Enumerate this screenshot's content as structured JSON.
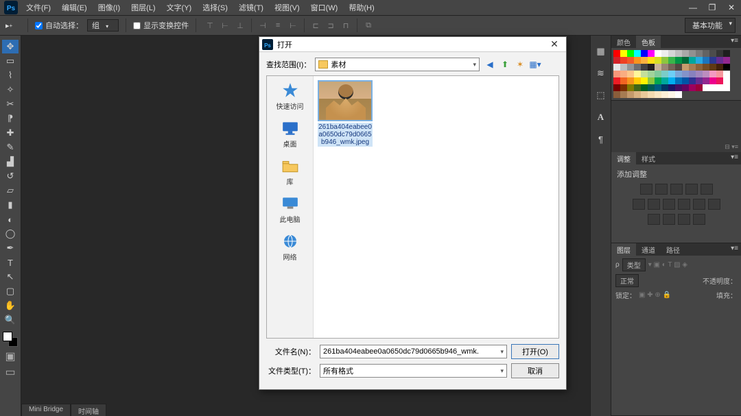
{
  "menubar": {
    "items": [
      "文件(F)",
      "编辑(E)",
      "图像(I)",
      "图层(L)",
      "文字(Y)",
      "选择(S)",
      "滤镜(T)",
      "视图(V)",
      "窗口(W)",
      "帮助(H)"
    ]
  },
  "optbar": {
    "auto_select_label": "自动选择：",
    "group_value": "组",
    "show_transform_label": "显示变换控件",
    "workspace": "基本功能"
  },
  "dialog": {
    "title": "打开",
    "lookin_label": "查找范围(I)：",
    "lookin_value": "素材",
    "places": [
      {
        "label": "快速访问"
      },
      {
        "label": "桌面"
      },
      {
        "label": "库"
      },
      {
        "label": "此电脑"
      },
      {
        "label": "网络"
      }
    ],
    "thumb_name": "261ba404eabee0a0650dc79d0665b946_wmk.jpeg",
    "filename_label": "文件名(N)：",
    "filename_value": "261ba404eabee0a0650dc79d0665b946_wmk.",
    "filetype_label": "文件类型(T)：",
    "filetype_value": "所有格式",
    "open_btn": "打开(O)",
    "cancel_btn": "取消"
  },
  "panels": {
    "color_tab": "颜色",
    "swatches_tab": "色板",
    "adjust_tab": "调整",
    "styles_tab": "样式",
    "adjust_title": "添加调整",
    "layers_tab": "图层",
    "channels_tab": "通道",
    "paths_tab": "路径",
    "layers_kind": "类型",
    "layers_mode": "正常",
    "layers_opacity_label": "不透明度：",
    "layers_lock_label": "锁定：",
    "layers_fill_label": "填充："
  },
  "doc_tabs": {
    "t1": "Mini Bridge",
    "t2": "时间轴"
  },
  "swatch_colors": [
    "#ff0000",
    "#ffff00",
    "#00ff00",
    "#00ffff",
    "#0000ff",
    "#ff00ff",
    "#ffffff",
    "#ededed",
    "#d6d6d6",
    "#bfbfbf",
    "#a8a8a8",
    "#919191",
    "#7a7a7a",
    "#636363",
    "#4c4c4c",
    "#353535",
    "#1e1e1e",
    "#d2232a",
    "#ef4023",
    "#f15a29",
    "#f7941e",
    "#fbb040",
    "#ffde17",
    "#d7df23",
    "#8dc63f",
    "#39b54a",
    "#009444",
    "#006838",
    "#00a79d",
    "#27aae1",
    "#1c75bc",
    "#2b3990",
    "#662d91",
    "#92278f",
    "#e6e7e8",
    "#bcbec0",
    "#939598",
    "#6d6e71",
    "#414042",
    "#231f20",
    "#c7b299",
    "#998675",
    "#736357",
    "#534741",
    "#c69c6d",
    "#a67c52",
    "#8c6239",
    "#754c24",
    "#603913",
    "#42210b",
    "#000000",
    "#f7977a",
    "#f9ad81",
    "#fdc68a",
    "#fff79a",
    "#c4df9b",
    "#a2d39c",
    "#82ca9d",
    "#7bcdc8",
    "#6ecff6",
    "#7ea7d8",
    "#8493ca",
    "#8882be",
    "#a187be",
    "#bc8dbf",
    "#f49ac2",
    "#f6989d",
    "#ffffff",
    "#ed1c24",
    "#f26522",
    "#f7941e",
    "#ffcb05",
    "#fff200",
    "#8dc63f",
    "#00a651",
    "#00a99d",
    "#00aeef",
    "#0072bc",
    "#0054a6",
    "#2e3192",
    "#662d91",
    "#92278f",
    "#ec008c",
    "#ed145b",
    "#ffffff",
    "#790000",
    "#7b2e00",
    "#827b00",
    "#406618",
    "#005e20",
    "#005952",
    "#005b7f",
    "#003663",
    "#1b1464",
    "#440e62",
    "#630460",
    "#9e005d",
    "#9e0039",
    "#ffffff",
    "#ffffff",
    "#ffffff",
    "#ffffff",
    "#8a5d3b",
    "#a67c52",
    "#c49a6c",
    "#d9b382",
    "#e8c99a",
    "#f2dab0",
    "#f8e6c3",
    "#fcefd6",
    "#fff7e8",
    "#ffffff"
  ]
}
